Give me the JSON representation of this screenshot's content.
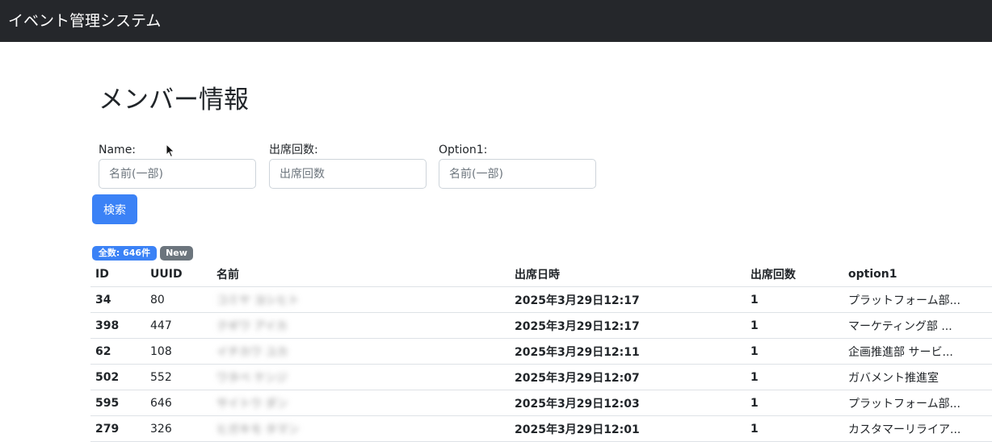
{
  "app": {
    "title": "イベント管理システム"
  },
  "page": {
    "title": "メンバー情報"
  },
  "search": {
    "name_label": "Name:",
    "name_placeholder": "名前(一部)",
    "attendance_label": "出席回数:",
    "attendance_placeholder": "出席回数",
    "option1_label": "Option1:",
    "option1_placeholder": "名前(一部)",
    "button_label": "検索"
  },
  "badges": {
    "total": "全数: 646件",
    "new": "New"
  },
  "table": {
    "headers": [
      "ID",
      "UUID",
      "名前",
      "出席日時",
      "出席回数",
      "option1"
    ],
    "rows": [
      {
        "id": "34",
        "uuid": "80",
        "name": "コミヤ ヨシヒト",
        "datetime": "2025年3月29日12:17",
        "count": "1",
        "option1": "プラットフォーム部..."
      },
      {
        "id": "398",
        "uuid": "447",
        "name": "クギワ アイカ",
        "datetime": "2025年3月29日12:17",
        "count": "1",
        "option1": "マーケティング部 ..."
      },
      {
        "id": "62",
        "uuid": "108",
        "name": "イチカワ ユカ",
        "datetime": "2025年3月29日12:11",
        "count": "1",
        "option1": "企画推進部 サービ..."
      },
      {
        "id": "502",
        "uuid": "552",
        "name": "ワタベ ケンジ",
        "datetime": "2025年3月29日12:07",
        "count": "1",
        "option1": "ガバメント推進室"
      },
      {
        "id": "595",
        "uuid": "646",
        "name": "サイトウ ダン",
        "datetime": "2025年3月29日12:03",
        "count": "1",
        "option1": "プラットフォーム部..."
      },
      {
        "id": "279",
        "uuid": "326",
        "name": "ヒガキモ タマン",
        "datetime": "2025年3月29日12:01",
        "count": "1",
        "option1": "カスタマーリライア..."
      }
    ]
  },
  "colors": {
    "navbar": "#25272b",
    "primary": "#3b82f6",
    "secondary": "#6c757d"
  },
  "icons": {
    "cursor": "mouse-cursor-icon"
  }
}
